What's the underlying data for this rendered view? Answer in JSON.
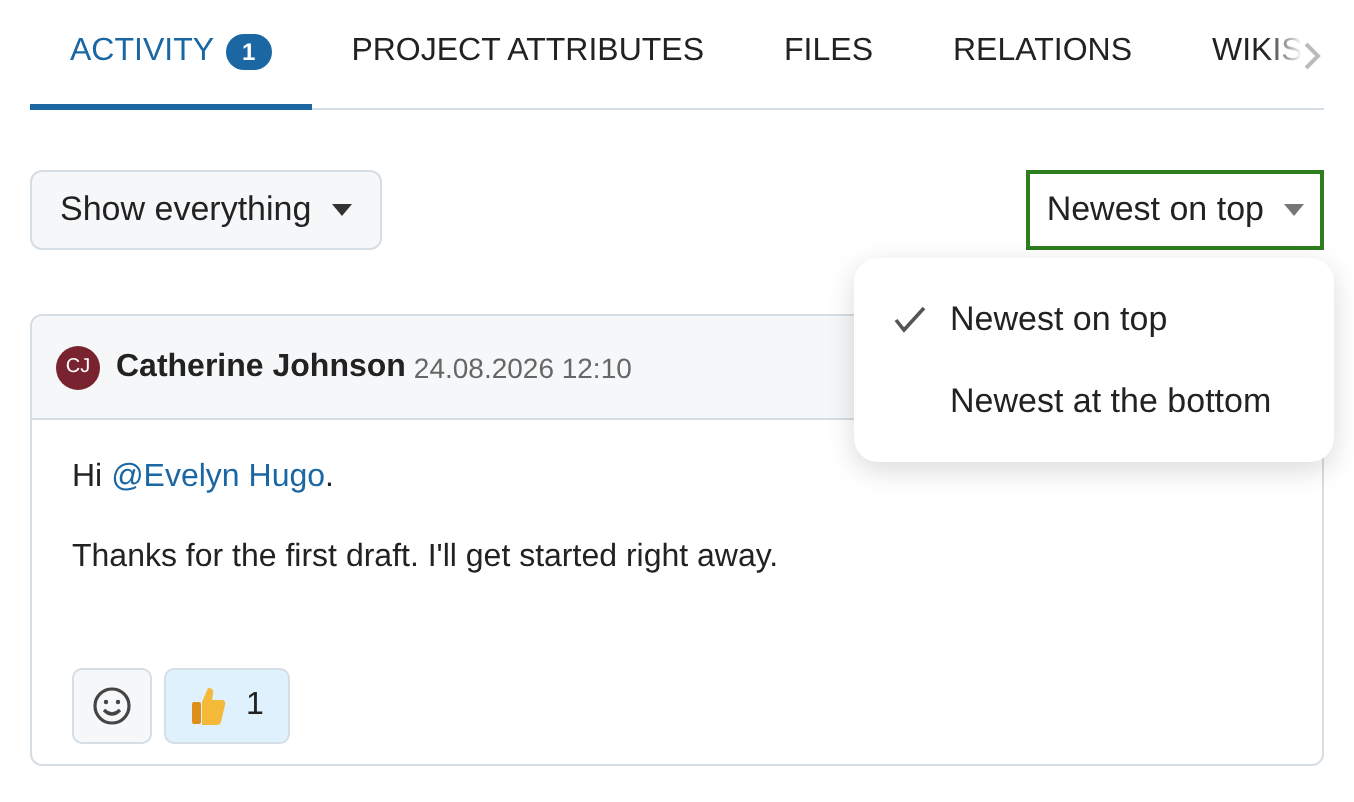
{
  "tabs": [
    {
      "label": "ACTIVITY",
      "badge": "1",
      "selected": true
    },
    {
      "label": "PROJECT ATTRIBUTES",
      "selected": false
    },
    {
      "label": "FILES",
      "selected": false
    },
    {
      "label": "RELATIONS",
      "selected": false
    },
    {
      "label": "WIKIS",
      "selected": false
    }
  ],
  "filter": {
    "label": "Show everything"
  },
  "sort": {
    "label": "Newest on top",
    "focused": true
  },
  "sort_menu": [
    {
      "label": "Newest on top",
      "selected": true
    },
    {
      "label": "Newest at the bottom",
      "selected": false
    }
  ],
  "comment": {
    "initials": "CJ",
    "author": "Catherine Johnson",
    "time": "24.08.2026 12:10",
    "greeting": {
      "prefix": "Hi ",
      "mention": "@Evelyn Hugo",
      "suffix": "."
    },
    "body": "Thanks for the first draft. I'll get started right away.",
    "reactions": [
      {
        "count": "1"
      }
    ]
  }
}
